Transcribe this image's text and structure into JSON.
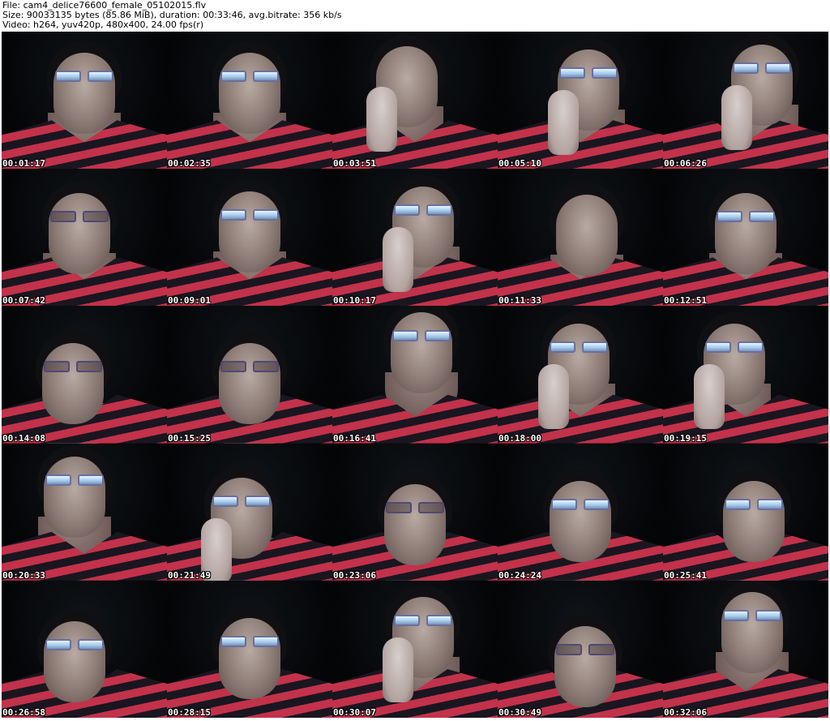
{
  "header": {
    "file_line": "File: cam4_delice76600_female_05102015.flv",
    "size_line": "Size: 90033135 bytes (85.86 MiB), duration: 00:33:46, avg.bitrate: 356 kb/s",
    "video_line": "Video: h264, yuv420p, 480x400, 24.00 fps(r)"
  },
  "frames": [
    {
      "timestamp": "00:01:17",
      "glasses": "bright",
      "hand": false
    },
    {
      "timestamp": "00:02:35",
      "glasses": "bright",
      "hand": false
    },
    {
      "timestamp": "00:03:51",
      "glasses": "none",
      "hand": true
    },
    {
      "timestamp": "00:05:10",
      "glasses": "bright",
      "hand": true
    },
    {
      "timestamp": "00:06:26",
      "glasses": "bright",
      "hand": true
    },
    {
      "timestamp": "00:07:42",
      "glasses": "dark",
      "hand": false
    },
    {
      "timestamp": "00:09:01",
      "glasses": "bright",
      "hand": false
    },
    {
      "timestamp": "00:10:17",
      "glasses": "bright",
      "hand": true
    },
    {
      "timestamp": "00:11:33",
      "glasses": "none",
      "hand": false
    },
    {
      "timestamp": "00:12:51",
      "glasses": "bright",
      "hand": false
    },
    {
      "timestamp": "00:14:08",
      "glasses": "dark",
      "hand": false
    },
    {
      "timestamp": "00:15:25",
      "glasses": "dark",
      "hand": false
    },
    {
      "timestamp": "00:16:41",
      "glasses": "bright",
      "hand": false
    },
    {
      "timestamp": "00:18:00",
      "glasses": "bright",
      "hand": true
    },
    {
      "timestamp": "00:19:15",
      "glasses": "bright",
      "hand": true
    },
    {
      "timestamp": "00:20:33",
      "glasses": "bright",
      "hand": false
    },
    {
      "timestamp": "00:21:49",
      "glasses": "bright",
      "hand": true
    },
    {
      "timestamp": "00:23:06",
      "glasses": "dark",
      "hand": false
    },
    {
      "timestamp": "00:24:24",
      "glasses": "bright",
      "hand": false
    },
    {
      "timestamp": "00:25:41",
      "glasses": "bright",
      "hand": false
    },
    {
      "timestamp": "00:26:58",
      "glasses": "bright",
      "hand": false
    },
    {
      "timestamp": "00:28:15",
      "glasses": "bright",
      "hand": false
    },
    {
      "timestamp": "00:30:07",
      "glasses": "bright",
      "hand": true
    },
    {
      "timestamp": "00:30:49",
      "glasses": "dark",
      "hand": false
    },
    {
      "timestamp": "00:32:06",
      "glasses": "bright",
      "hand": false
    }
  ],
  "colors": {
    "background": "#000000",
    "shirt_red": "#c2324a",
    "shirt_dark": "#1a1620",
    "header_text": "#000000",
    "timestamp_text": "#ffffff"
  }
}
